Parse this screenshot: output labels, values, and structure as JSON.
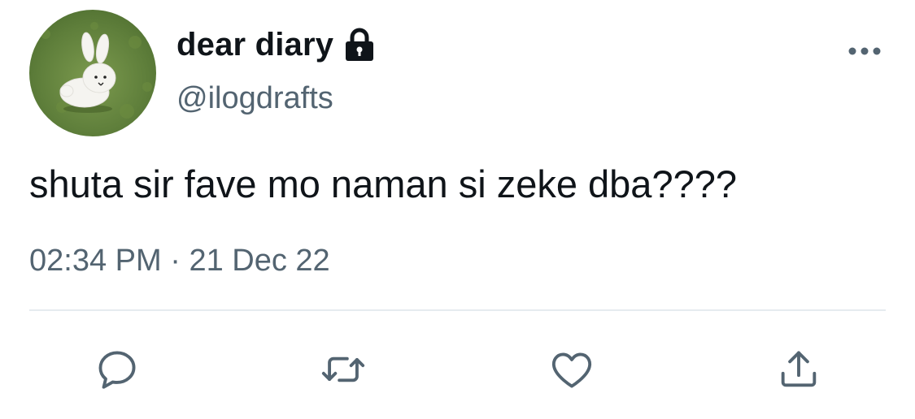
{
  "user": {
    "display_name": "dear diary",
    "handle": "@ilogdrafts",
    "protected": true
  },
  "tweet": {
    "text": "shuta sir fave mo naman si zeke dba????",
    "time": "02:34 PM",
    "separator": "·",
    "date": "21 Dec 22"
  },
  "actions": [
    "reply-icon",
    "retweet-icon",
    "like-icon",
    "share-icon"
  ],
  "colors": {
    "text": "#0f1419",
    "secondary": "#536471",
    "divider": "#e6ebef",
    "background": "#ffffff"
  }
}
